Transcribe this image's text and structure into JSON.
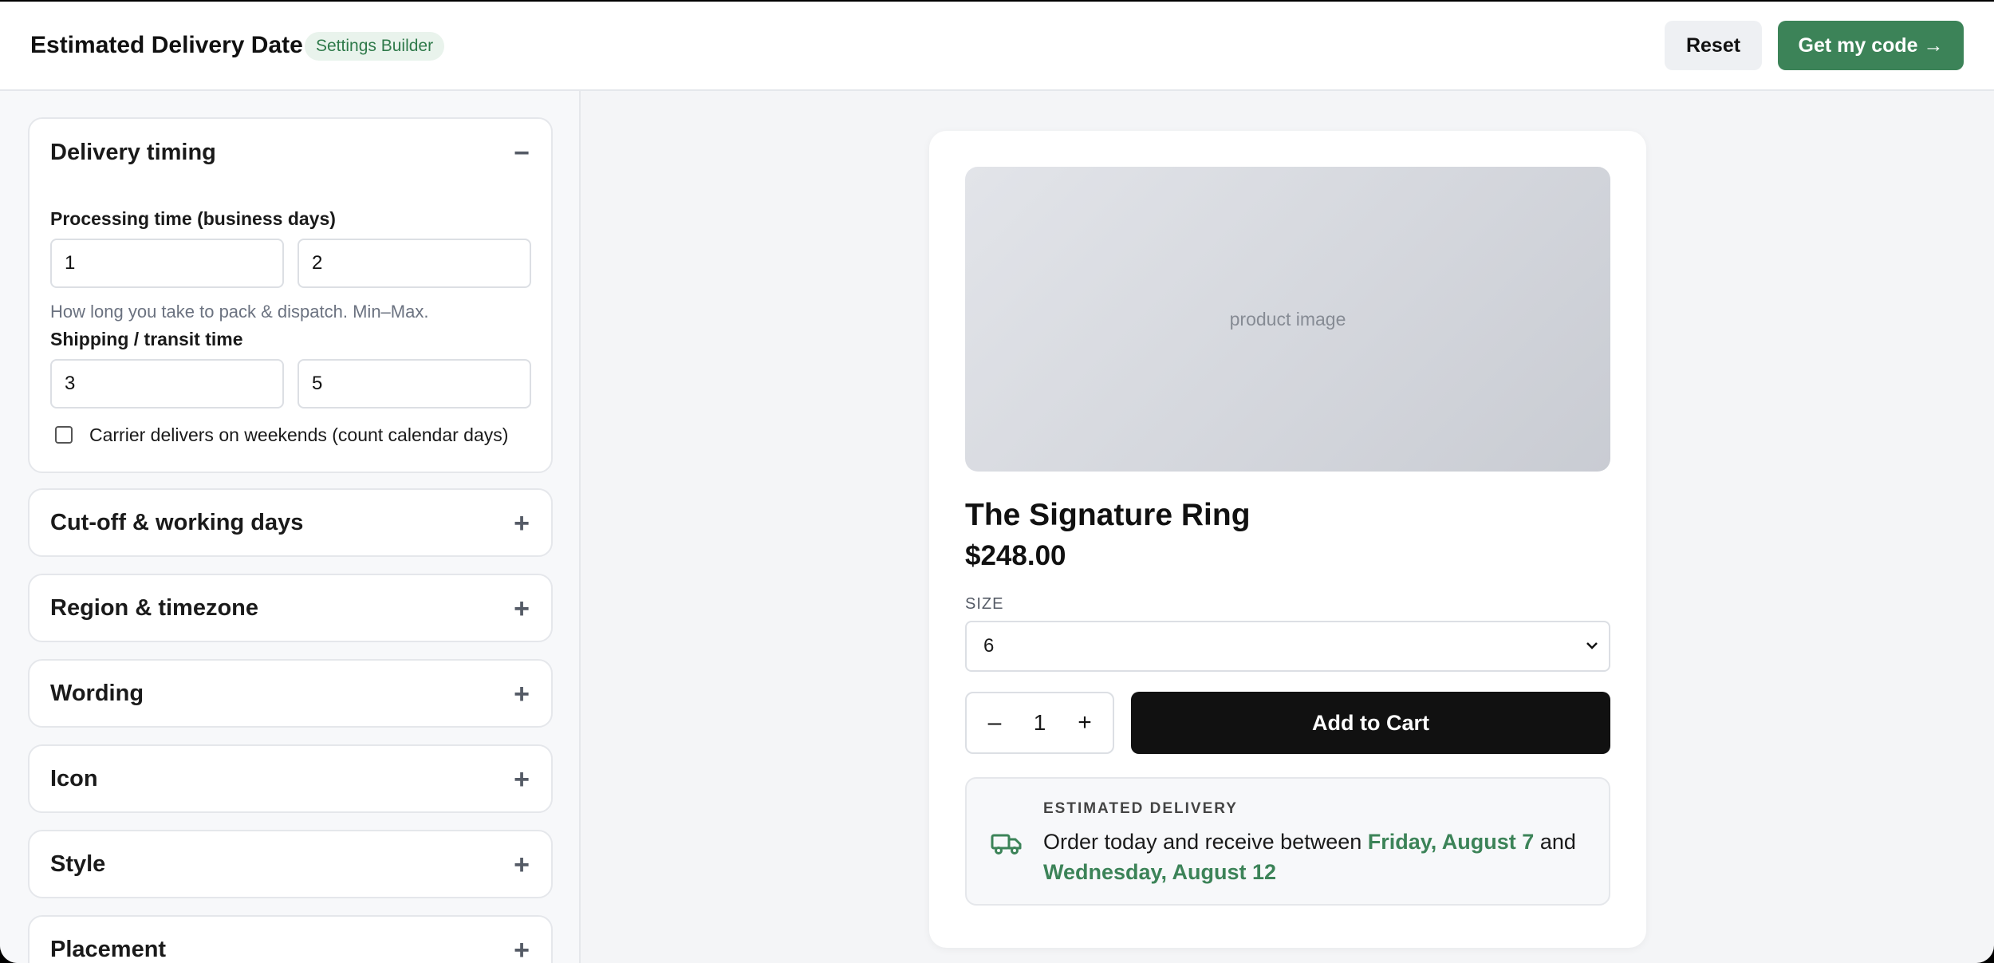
{
  "header": {
    "title": "Estimated Delivery Date",
    "badge": "Settings Builder",
    "reset_label": "Reset",
    "get_code_label": "Get my code →"
  },
  "settings": {
    "delivery_timing": {
      "title": "Delivery timing",
      "toggle": "−",
      "processing_label": "Processing time (business days)",
      "processing_min": "1",
      "processing_max": "2",
      "processing_hint": "How long you take to pack & dispatch. Min–Max.",
      "shipping_label": "Shipping / transit time",
      "shipping_min": "3",
      "shipping_max": "5",
      "weekends_label": "Carrier delivers on weekends (count calendar days)",
      "weekends_checked": false
    },
    "sections": [
      {
        "title": "Cut-off & working days",
        "toggle": "+"
      },
      {
        "title": "Region & timezone",
        "toggle": "+"
      },
      {
        "title": "Wording",
        "toggle": "+"
      },
      {
        "title": "Icon",
        "toggle": "+"
      },
      {
        "title": "Style",
        "toggle": "+"
      },
      {
        "title": "Placement",
        "toggle": "+"
      }
    ]
  },
  "preview": {
    "image_placeholder": "product image",
    "product_name": "The Signature Ring",
    "price": "$248.00",
    "size_label": "SIZE",
    "size_value": "6",
    "qty_minus": "–",
    "qty_value": "1",
    "qty_plus": "+",
    "add_to_cart": "Add to Cart",
    "delivery_heading": "ESTIMATED DELIVERY",
    "delivery_prefix": "Order today and receive between",
    "delivery_start": "Friday, August 7",
    "delivery_joiner": "and",
    "delivery_end": "Wednesday, August 12"
  },
  "colors": {
    "accent": "#3c8358",
    "badge_bg": "#e9f3ec",
    "cart_button": "#111111"
  },
  "icons": [
    "truck-icon",
    "chevron-down-icon",
    "minus-icon",
    "plus-icon"
  ]
}
